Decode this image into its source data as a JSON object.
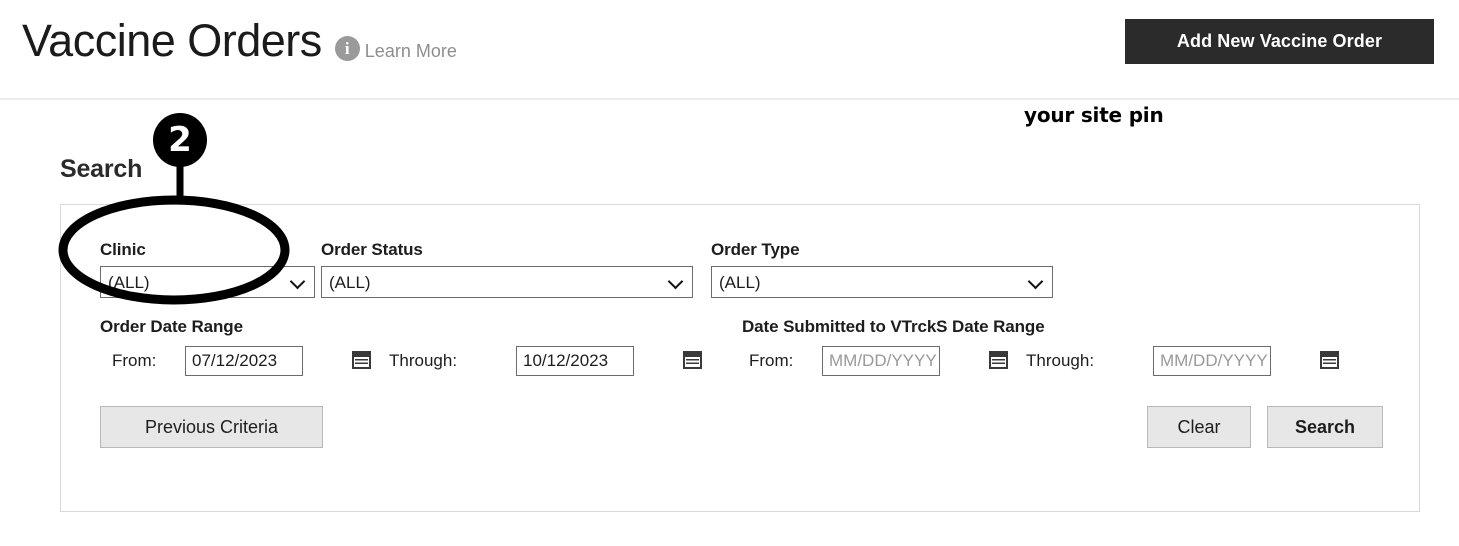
{
  "header": {
    "title": "Vaccine Orders",
    "info_icon": "info-circle-icon",
    "learn_more_label": "Learn More",
    "add_order_label": "Add New Vaccine Order",
    "add_order_bg": "#2b2b2b"
  },
  "annotations": {
    "site_pin_note": "your site pin",
    "callout_number": "2"
  },
  "search": {
    "heading": "Search",
    "clinic": {
      "label": "Clinic",
      "value": "(ALL)",
      "options": [
        "(ALL)"
      ]
    },
    "order_status": {
      "label": "Order Status",
      "value": "(ALL)",
      "options": [
        "(ALL)"
      ]
    },
    "order_type": {
      "label": "Order Type",
      "value": "(ALL)",
      "options": [
        "(ALL)"
      ]
    },
    "order_date_range": {
      "label": "Order Date Range",
      "from_label": "From:",
      "from_value": "07/12/2023",
      "through_label": "Through:",
      "through_value": "10/12/2023"
    },
    "vtrcks_date_range": {
      "label": "Date Submitted to VTrckS Date Range",
      "from_label": "From:",
      "from_placeholder": "MM/DD/YYYY",
      "from_value": "",
      "through_label": "Through:",
      "through_placeholder": "MM/DD/YYYY",
      "through_value": ""
    },
    "buttons": {
      "previous_criteria": "Previous Criteria",
      "clear": "Clear",
      "search": "Search"
    }
  }
}
